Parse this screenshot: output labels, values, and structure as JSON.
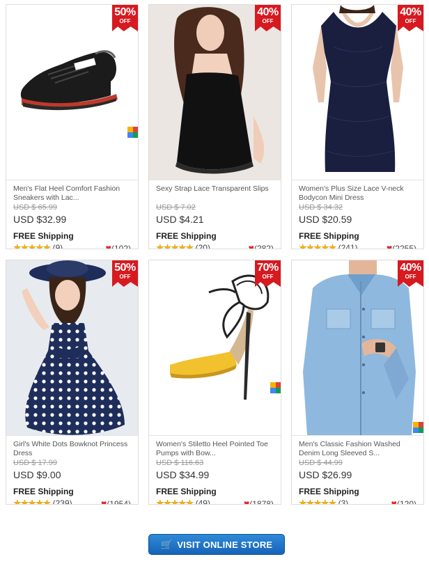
{
  "products": [
    {
      "discount": "50%",
      "off": "OFF",
      "title": "Men's Flat Heel Comfort Fashion Sneakers with Lac...",
      "old_price": "USD $ 65.99",
      "price": "USD $32.99",
      "shipping": "FREE Shipping",
      "reviews": "(9)",
      "favorites": "(102)",
      "image": "black-sneaker",
      "white_bg": true
    },
    {
      "discount": "40%",
      "off": "OFF",
      "title": "Sexy Strap Lace Transparent Slips",
      "old_price": "USD $ 7.02",
      "price": "USD $4.21",
      "shipping": "FREE Shipping",
      "reviews": "(20)",
      "favorites": "(282)",
      "image": "black-slip",
      "white_bg": false
    },
    {
      "discount": "40%",
      "off": "OFF",
      "title": "Women's Plus Size Lace V-neck Bodycon Mini Dress",
      "old_price": "USD $ 34.32",
      "price": "USD $20.59",
      "shipping": "FREE Shipping",
      "reviews": "(241)",
      "favorites": "(2255)",
      "image": "navy-lace-dress",
      "white_bg": true
    },
    {
      "discount": "50%",
      "off": "OFF",
      "title": "Girl's White Dots Bowknot Princess Dress",
      "old_price": "USD $ 17.99",
      "price": "USD $9.00",
      "shipping": "FREE Shipping",
      "reviews": "(239)",
      "favorites": "(1954)",
      "image": "polka-dot-dress",
      "white_bg": false
    },
    {
      "discount": "70%",
      "off": "OFF",
      "title": "Women's Stiletto Heel Pointed Toe Pumps with Bow...",
      "old_price": "USD $ 116.63",
      "price": "USD $34.99",
      "shipping": "FREE Shipping",
      "reviews": "(49)",
      "favorites": "(1878)",
      "image": "yellow-pump",
      "white_bg": true
    },
    {
      "discount": "40%",
      "off": "OFF",
      "title": "Men's Classic Fashion Washed Denim Long Sleeved S...",
      "old_price": "USD $ 44.99",
      "price": "USD $26.99",
      "shipping": "FREE Shipping",
      "reviews": "(3)",
      "favorites": "(120)",
      "image": "denim-shirt",
      "white_bg": true
    }
  ],
  "colors": {
    "badge": "#d71920",
    "star": "#f5b301",
    "heart": "#e0262e",
    "button": "#1f6fc4"
  },
  "cta": {
    "label": "VISIT ONLINE STORE",
    "icon": "cart-icon"
  }
}
